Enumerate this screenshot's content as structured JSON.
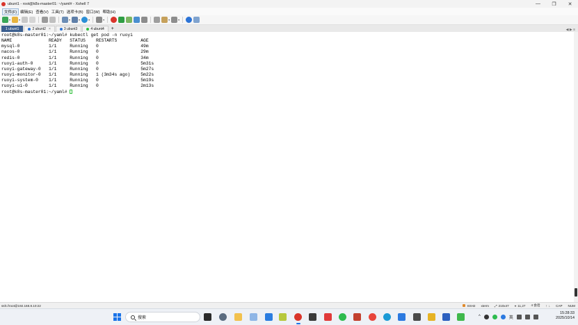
{
  "window": {
    "title": "ubunt1 - root@k8s-master01: ~/yaml# - Xshell 7",
    "controls": [
      "—",
      "❐",
      "✕"
    ]
  },
  "menubar": {
    "items": [
      "文件(F)",
      "编辑(E)",
      "查看(V)",
      "工具(T)",
      "选项卡(B)",
      "窗口(W)",
      "帮助(H)"
    ]
  },
  "tabs": {
    "items": [
      {
        "label": "1 ubunt1",
        "active": true
      },
      {
        "label": "2 ubunt2",
        "active": false
      },
      {
        "label": "3 ubunt3",
        "active": false
      },
      {
        "label": "4 ubunt4",
        "active": false
      }
    ],
    "add": "+",
    "nav": "◀ ▶ ≡"
  },
  "terminal": {
    "lines": [
      "root@k8s-master01:~/yaml# kubectl get pod -n ruoyi",
      "NAME              READY   STATUS    RESTARTS         AGE",
      "mysql-0           1/1     Running   0                49m",
      "nacos-0           1/1     Running   0                29m",
      "redis-0           1/1     Running   0                34m",
      "ruoyi-auth-0      1/1     Running   0                5m31s",
      "ruoyi-gateway-0   1/1     Running   0                5m27s",
      "ruoyi-monitor-0   1/1     Running   1 (3m34s ago)    5m22s",
      "ruoyi-system-0    1/1     Running   0                5m19s",
      "ruoyi-ui-0        1/1     Running   0                2m13s"
    ],
    "prompt": "root@k8s-master01:~/yaml# "
  },
  "statusbar": {
    "connection": "ssh://root@192.168.8.10:22",
    "protocol": "SSH2",
    "terminal_type": "xterm",
    "size": "210x47",
    "cursor_pos": "11,27",
    "sessions": "4 会话",
    "caps": "CAP",
    "num": "NUM"
  },
  "taskbar": {
    "search_placeholder": "搜索",
    "tray_lang": "英",
    "time": "15:28:33",
    "date": "2025/10/14"
  },
  "colors": {
    "active_tab": "#3c5f8f",
    "cursor": "#2fbf3a",
    "app_icon": "#d9352b"
  }
}
